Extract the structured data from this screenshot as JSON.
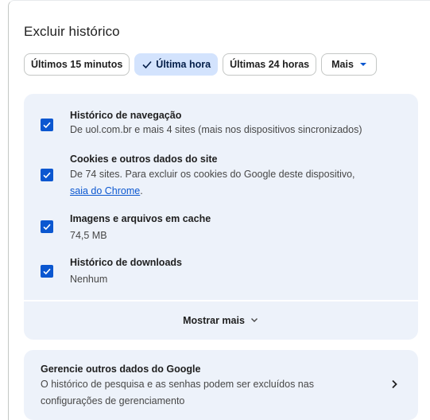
{
  "dialog": {
    "title": "Excluir histórico"
  },
  "time_range": {
    "chips": [
      {
        "label": "Últimos 15 minutos",
        "selected": false
      },
      {
        "label": "Última hora",
        "selected": true
      },
      {
        "label": "Últimas 24 horas",
        "selected": false
      },
      {
        "label": "Mais",
        "selected": false
      }
    ]
  },
  "data_types": [
    {
      "title": "Histórico de navegação",
      "desc": "De uol.com.br e mais 4 sites (mais nos dispositivos sincronizados)",
      "checked": true
    },
    {
      "title": "Cookies e outros dados do site",
      "desc": "De 74 sites. Para excluir os cookies do Google deste dispositivo,",
      "link": "saia do Chrome",
      "link_suffix": ".",
      "checked": true
    },
    {
      "title": "Imagens e arquivos em cache",
      "desc": "74,5 MB",
      "checked": true
    },
    {
      "title": "Histórico de downloads",
      "desc": "Nenhum",
      "checked": true
    }
  ],
  "show_more": {
    "label": "Mostrar mais"
  },
  "manage": {
    "title": "Gerencie outros dados do Google",
    "desc": "O histórico de pesquisa e as senhas podem ser excluídos nas configurações de gerenciamento"
  },
  "colors": {
    "accent": "#0b57d0",
    "selected_chip_bg": "#d3e3fd",
    "panel_bg": "#edf2fa"
  }
}
